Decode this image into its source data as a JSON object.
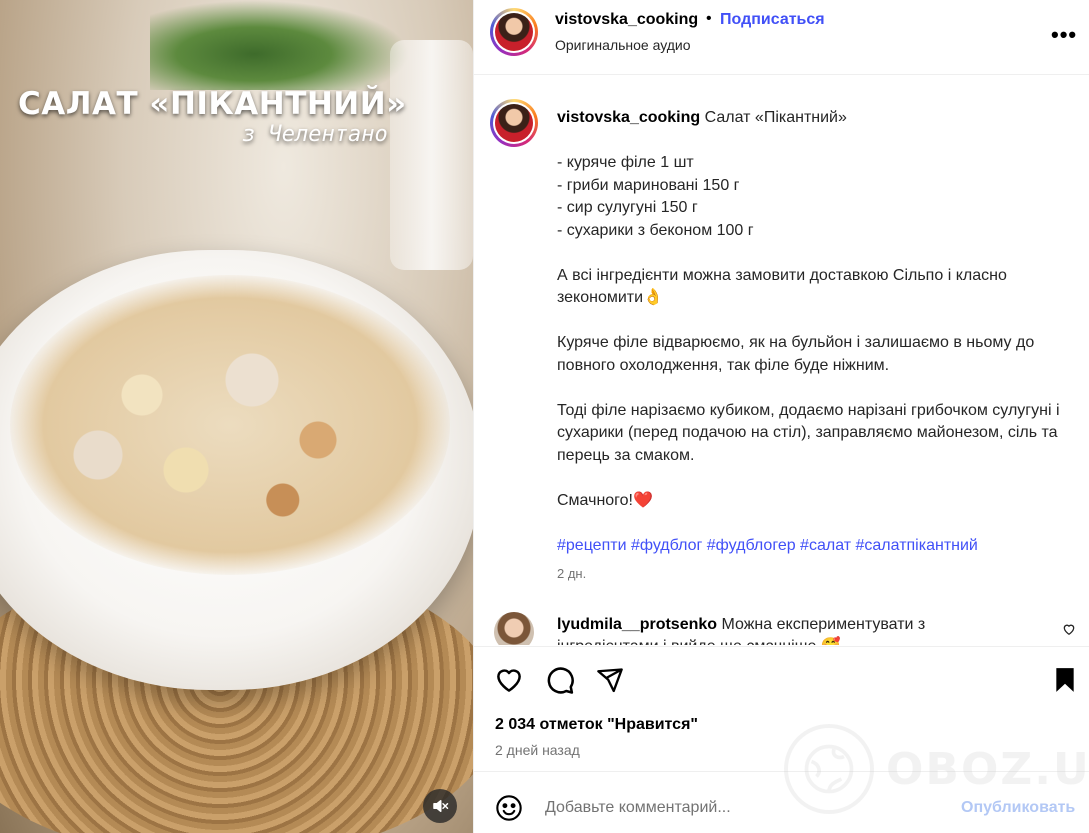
{
  "media": {
    "title": "САЛАТ «ПІКАНТНИЙ»",
    "subtitle": "з Челентано",
    "mute_icon": "speaker-muted-icon"
  },
  "header": {
    "username": "vistovska_cooking",
    "separator": "•",
    "follow_label": "Подписаться",
    "audio": "Оригинальное аудио",
    "more_icon": "ellipsis-icon",
    "more_label": "•••"
  },
  "caption": {
    "username": "vistovska_cooking",
    "title": "Салат «Пікантний»",
    "ingredients": [
      "- куряче філе 1 шт",
      "- гриби мариновані 150 г",
      "- сир сулугуні 150 г",
      "- сухарики з беконом 100 г"
    ],
    "paragraph1": "А всі інгредієнти можна замовити доставкою Сільпо і класно зекономити👌",
    "paragraph2": "Куряче філе відварюємо, як на бульйон і залишаємо в ньому до повного охолодження, так філе буде ніжним.",
    "paragraph3": "Тоді філе нарізаємо кубиком, додаємо нарізані грибочком сулугуні і сухарики (перед подачою на стіл), заправляємо майонезом, сіль та перець за смаком.",
    "closing": "Смачного!❤️",
    "hashtags": "#рецепти #фудблог #фудблогер #салат #салатпікантний",
    "age": "2 дн."
  },
  "comment": {
    "username": "lyudmila__protsenko",
    "text": "Можна експериментувати з інгредієнтами і вийде ще смачніше 🥰"
  },
  "actions": {
    "likes": "2 034 отметок \"Нравится\"",
    "date": "2 дней назад"
  },
  "add_comment": {
    "placeholder": "Добавьте комментарий...",
    "post_label": "Опубликовать"
  },
  "watermark": {
    "text": "OBOZ.UA"
  },
  "colors": {
    "link_blue": "#4150f7",
    "post_disabled": "#b3c8f5",
    "muted_text": "#737373",
    "heart_red": "#ff3040"
  }
}
